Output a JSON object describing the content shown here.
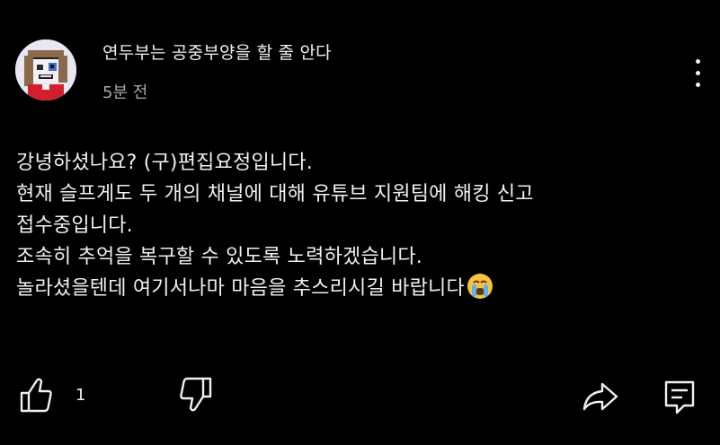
{
  "comment": {
    "author": "연두부는 공중부양을 할 줄 안다",
    "time": "5분 전",
    "lines": [
      "강녕하셨나요? (구)편집요정입니다.",
      "현재 슬프게도 두 개의 채널에 대해 유튜브 지원팀에 해킹 신고",
      "접수중입니다.",
      "조속히 추억을 복구할 수 있도록 노력하겠습니다.",
      "놀라셨을텐데 여기서나마 마음을 추스리시길 바랍니다"
    ],
    "trailing_emoji": "crying-face",
    "like_count": "1"
  },
  "icons": {
    "like": "thumbs-up-icon",
    "dislike": "thumbs-down-icon",
    "share": "share-arrow-icon",
    "reply": "reply-comment-icon",
    "more": "more-vertical-icon"
  },
  "colors": {
    "background": "#000000",
    "text": "#f1f1f1",
    "secondary_text": "#aaaaaa",
    "avatar_bg": "#e9e6f4"
  }
}
